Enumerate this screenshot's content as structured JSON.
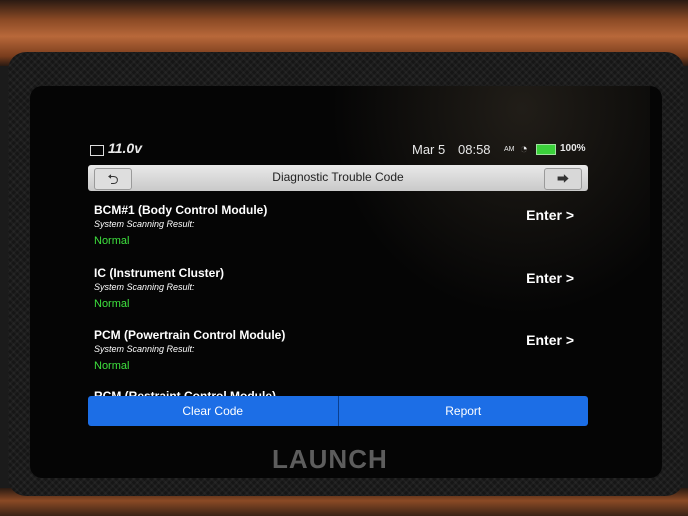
{
  "status_bar": {
    "voltage": "11.0v",
    "date": "Mar 5",
    "time": "08:58",
    "ampm": "AM",
    "battery": "100%"
  },
  "header": {
    "title": "Diagnostic Trouble Code"
  },
  "modules": [
    {
      "name": "BCM#1 (Body Control Module)",
      "result_label": "System Scanning Result:",
      "result": "Normal",
      "action": "Enter >"
    },
    {
      "name": "IC (Instrument Cluster)",
      "result_label": "System Scanning Result:",
      "result": "Normal",
      "action": "Enter >"
    },
    {
      "name": "PCM (Powertrain Control Module)",
      "result_label": "System Scanning Result:",
      "result": "Normal",
      "action": "Enter >"
    },
    {
      "name": "RCM (Restraint Control Module)",
      "result_label": "",
      "result": "",
      "action": ""
    }
  ],
  "actions": {
    "clear_code": "Clear Code",
    "report": "Report"
  },
  "brand": "LAUNCH",
  "colors": {
    "accent_blue": "#1c6ee6",
    "normal_green": "#3ee23e",
    "battery_green": "#3bd13b"
  }
}
